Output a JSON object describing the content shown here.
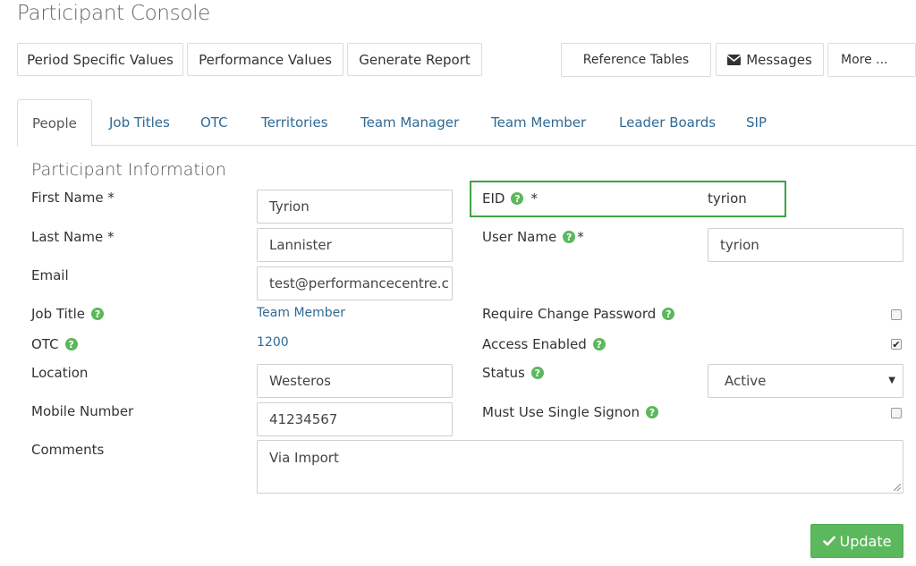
{
  "page_title": "Participant Console",
  "toolbar": {
    "period_specific_values": "Period Specific Values",
    "performance_values": "Performance Values",
    "generate_report": "Generate Report",
    "reference_tables": "Reference Tables",
    "messages": "Messages",
    "more": "More ..."
  },
  "tabs": [
    {
      "label": "People",
      "active": true
    },
    {
      "label": "Job Titles"
    },
    {
      "label": "OTC"
    },
    {
      "label": "Territories"
    },
    {
      "label": "Team Manager"
    },
    {
      "label": "Team Member"
    },
    {
      "label": "Leader Boards"
    },
    {
      "label": "SIP"
    }
  ],
  "form": {
    "section_title": "Participant Information",
    "first_name_label": "First Name *",
    "first_name_value": "Tyrion",
    "last_name_label": "Last Name *",
    "last_name_value": "Lannister",
    "email_label": "Email",
    "email_value": "test@performancecentre.c",
    "job_title_label": "Job Title",
    "job_title_value": "Team Member",
    "otc_label": "OTC",
    "otc_value": "1200",
    "location_label": "Location",
    "location_value": "Westeros",
    "mobile_label": "Mobile Number",
    "mobile_value": "41234567",
    "comments_label": "Comments",
    "comments_value": "Via Import",
    "eid_label": "EID",
    "eid_required": "*",
    "eid_value": "tyrion",
    "username_label": "User Name",
    "username_required": "*",
    "username_value": "tyrion",
    "require_change_password_label": "Require Change Password",
    "require_change_password_checked": false,
    "access_enabled_label": "Access Enabled",
    "access_enabled_checked": true,
    "status_label": "Status",
    "status_value": "Active",
    "single_signon_label": "Must Use Single Signon",
    "single_signon_checked": false
  },
  "update_button": "Update",
  "colors": {
    "accent_green": "#5cb85c",
    "link_blue": "#2f6a94",
    "highlight_border": "#3ea348"
  },
  "icons": {
    "messages": "envelope-icon",
    "help": "question-circle-icon",
    "update": "check-icon",
    "select": "caret-down-icon"
  }
}
